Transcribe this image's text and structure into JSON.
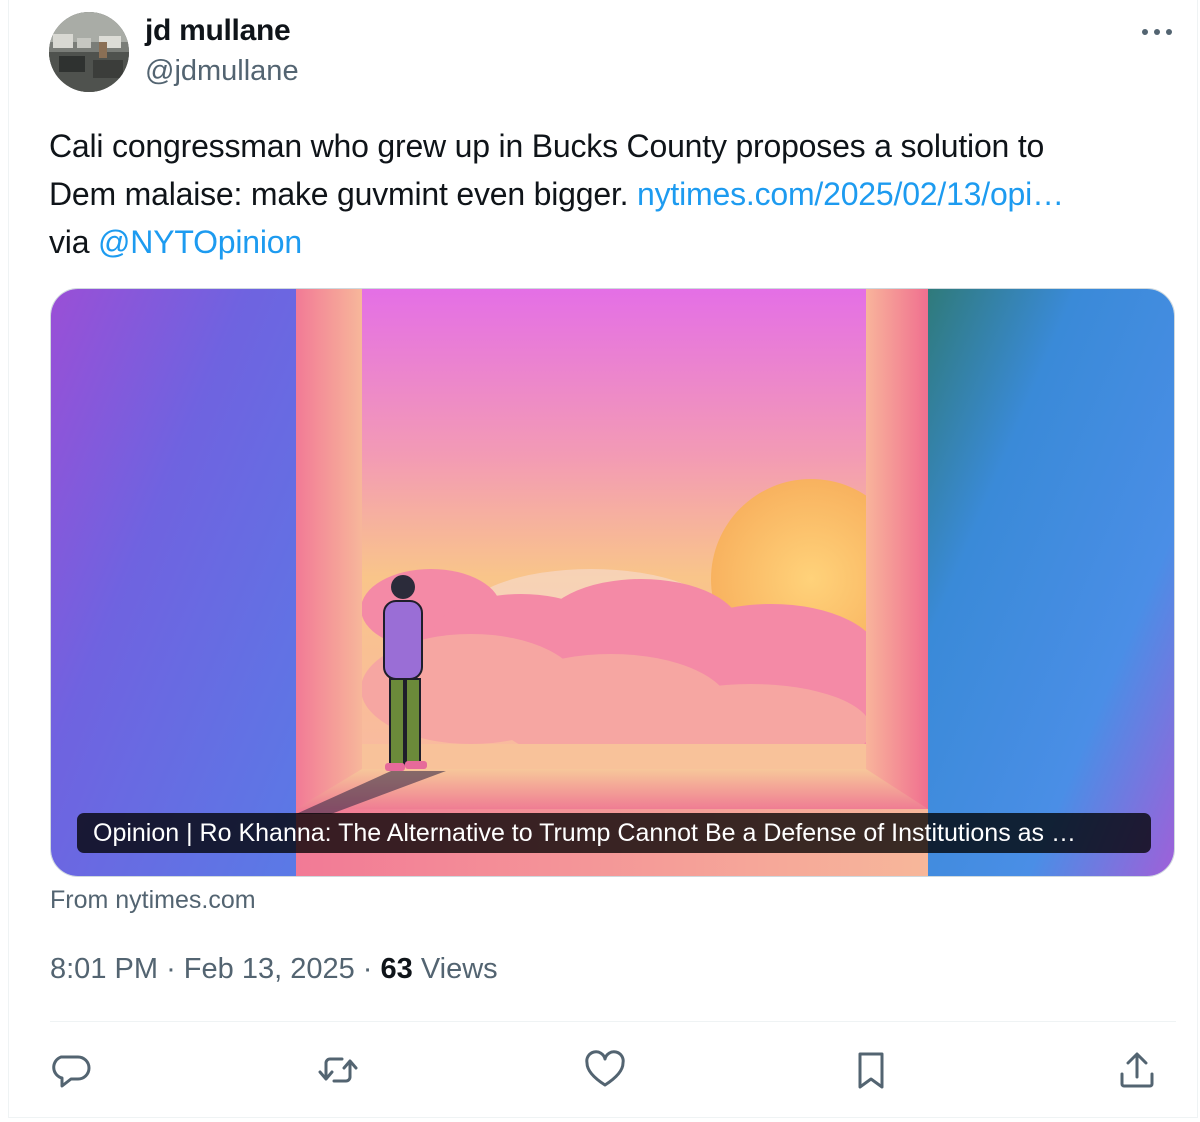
{
  "author": {
    "display_name": "jd mullane",
    "handle": "@jdmullane"
  },
  "tweet": {
    "text_line1": "Cali congressman who grew up in Bucks County proposes a solution to",
    "text_line2_prefix": "Dem malaise: make guvmint even bigger. ",
    "link_text": "nytimes.com/2025/02/13/opi…",
    "text_line3_prefix": "via ",
    "mention": "@NYTOpinion"
  },
  "card": {
    "title": "Opinion | Ro Khanna: The Alternative to Trump Cannot Be a Defense of Institutions as …",
    "source": "From nytimes.com"
  },
  "meta": {
    "time": "8:01 PM",
    "separator": "·",
    "date": "Feb 13, 2025",
    "views_count": "63",
    "views_label": "Views"
  },
  "actions": {
    "reply_icon": "reply-icon",
    "repost_icon": "repost-icon",
    "like_icon": "heart-icon",
    "bookmark_icon": "bookmark-icon",
    "share_icon": "share-icon"
  },
  "colors": {
    "link": "#1d9bf0",
    "secondary_text": "#536471",
    "primary_text": "#0f1419",
    "divider": "#eff3f4"
  }
}
